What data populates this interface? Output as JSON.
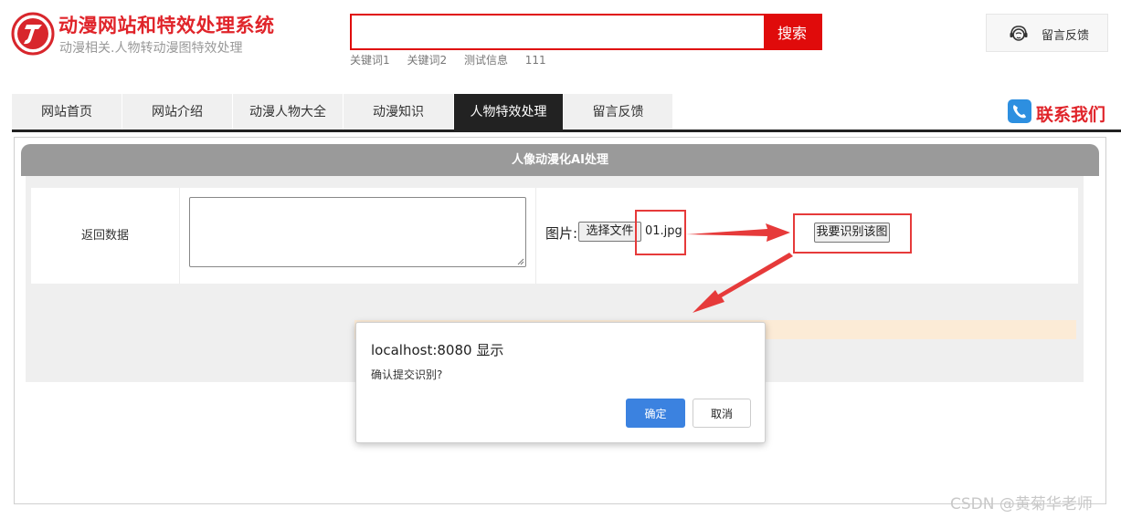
{
  "header": {
    "site_title": "动漫网站和特效处理系统",
    "site_subtitle": "动漫相关.人物转动漫图特效处理",
    "logo_icon": "j-logo-icon",
    "brand_color": "#e0242a"
  },
  "search": {
    "value": "",
    "button_label": "搜索",
    "keywords": [
      "关键词1",
      "关键词2",
      "测试信息",
      "111"
    ]
  },
  "feedback_button": {
    "label": "留言反馈",
    "icon": "headset-icon"
  },
  "nav": {
    "items": [
      {
        "label": "网站首页"
      },
      {
        "label": "网站介绍"
      },
      {
        "label": "动漫人物大全"
      },
      {
        "label": "动漫知识"
      },
      {
        "label": "人物特效处理",
        "active": true
      },
      {
        "label": "留言反馈"
      }
    ],
    "contact_label": "联系我们",
    "contact_icon": "phone-icon"
  },
  "panel": {
    "title": "人像动漫化AI处理",
    "row_label": "返回数据",
    "return_value": "",
    "pic_label": "图片:",
    "file_button_label": "选择文件",
    "file_name": "01.jpg",
    "identify_button_label": "我要识别该图"
  },
  "dialog": {
    "title": "localhost:8080 显示",
    "message": "确认提交识别?",
    "ok_label": "确定",
    "cancel_label": "取消"
  },
  "watermark": "CSDN @黄菊华老师"
}
